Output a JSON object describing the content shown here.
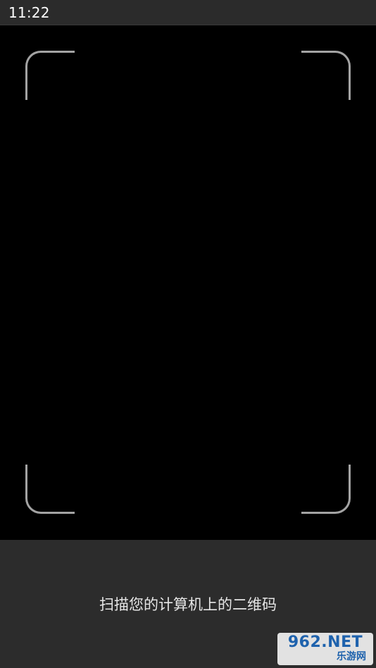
{
  "status_bar": {
    "time": "11:22"
  },
  "viewfinder": {
    "frame_color": "#a3a3a3",
    "background_color": "#000000"
  },
  "bottom_panel": {
    "instruction": "扫描您的计算机上的二维码",
    "background_color": "#2c2c2c"
  },
  "watermark": {
    "main_text": "962.NET",
    "sub_text": "乐游网"
  }
}
